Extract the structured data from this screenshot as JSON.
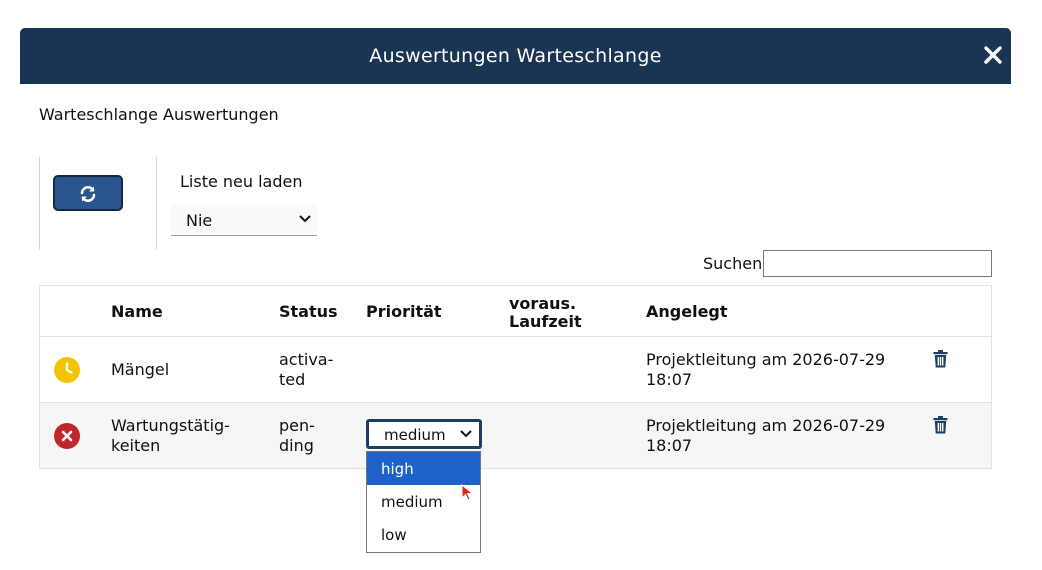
{
  "dialog": {
    "title": "Auswertungen Warteschlange",
    "close_icon": "close-icon",
    "header_color": "#1a3553"
  },
  "subtitle": "Warteschlange Auswertungen",
  "toolbar": {
    "refresh_icon": "refresh-icon",
    "reload_label": "Liste neu laden",
    "reload_value": "Nie"
  },
  "search": {
    "label": "Suchen",
    "value": ""
  },
  "table": {
    "headers": {
      "name": "Name",
      "status": "Status",
      "priority": "Priorität",
      "runtime_line1": "voraus.",
      "runtime_line2": "Laufzeit",
      "created": "Angelegt"
    },
    "rows": [
      {
        "status_icon": "clock-icon",
        "status_icon_color": "#f5c400",
        "name_line1": "Mängel",
        "name_line2": "",
        "status_line1": "activa-",
        "status_line2": "ted",
        "priority": "",
        "runtime": "",
        "created_line1": "Projektleitung am 2026-07-29",
        "created_line2": "18:07",
        "action_icon": "trash-icon"
      },
      {
        "status_icon": "error-icon",
        "status_icon_color": "#c0272d",
        "name_line1": "Wartungstätig-",
        "name_line2": "keiten",
        "status_line1": "pen-",
        "status_line2": "ding",
        "priority": "medium",
        "runtime": "",
        "created_line1": "Projektleitung am 2026-07-29",
        "created_line2": "18:07",
        "action_icon": "trash-icon"
      }
    ]
  },
  "priority_dropdown": {
    "options": [
      "high",
      "medium",
      "low"
    ],
    "highlighted": "high",
    "highlight_color": "#1e62c9"
  }
}
